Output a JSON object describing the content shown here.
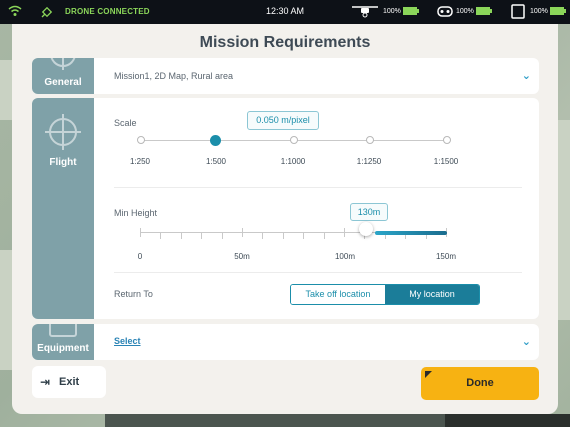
{
  "status_bar": {
    "connection": "DRONE CONNECTED",
    "time": "12:30 AM",
    "drone_battery": "100%",
    "controller_battery": "100%",
    "tablet_battery": "100%"
  },
  "title": "Mission Requirements",
  "general": {
    "tab_label": "General",
    "summary": "Mission1, 2D Map, Rural area"
  },
  "flight": {
    "tab_label": "Flight",
    "scale": {
      "label": "Scale",
      "value": "0.050 m/pixel",
      "selected": "1:500",
      "options": [
        "1:250",
        "1:500",
        "1:1000",
        "1:1250",
        "1:1500"
      ]
    },
    "min_height": {
      "label": "Min Height",
      "value": "130m",
      "ticks": [
        "0",
        "50m",
        "100m",
        "150m"
      ]
    },
    "return_to": {
      "label": "Return To",
      "options": [
        "Take off location",
        "My location"
      ],
      "selected": "My location"
    }
  },
  "equipment": {
    "tab_label": "Equipment",
    "select_label": "Select"
  },
  "buttons": {
    "exit": "Exit",
    "done": "Done"
  },
  "colors": {
    "accent": "#1b8eaa",
    "tab": "#7fa1a8",
    "done": "#f7b212",
    "connected": "#8bd65a"
  }
}
